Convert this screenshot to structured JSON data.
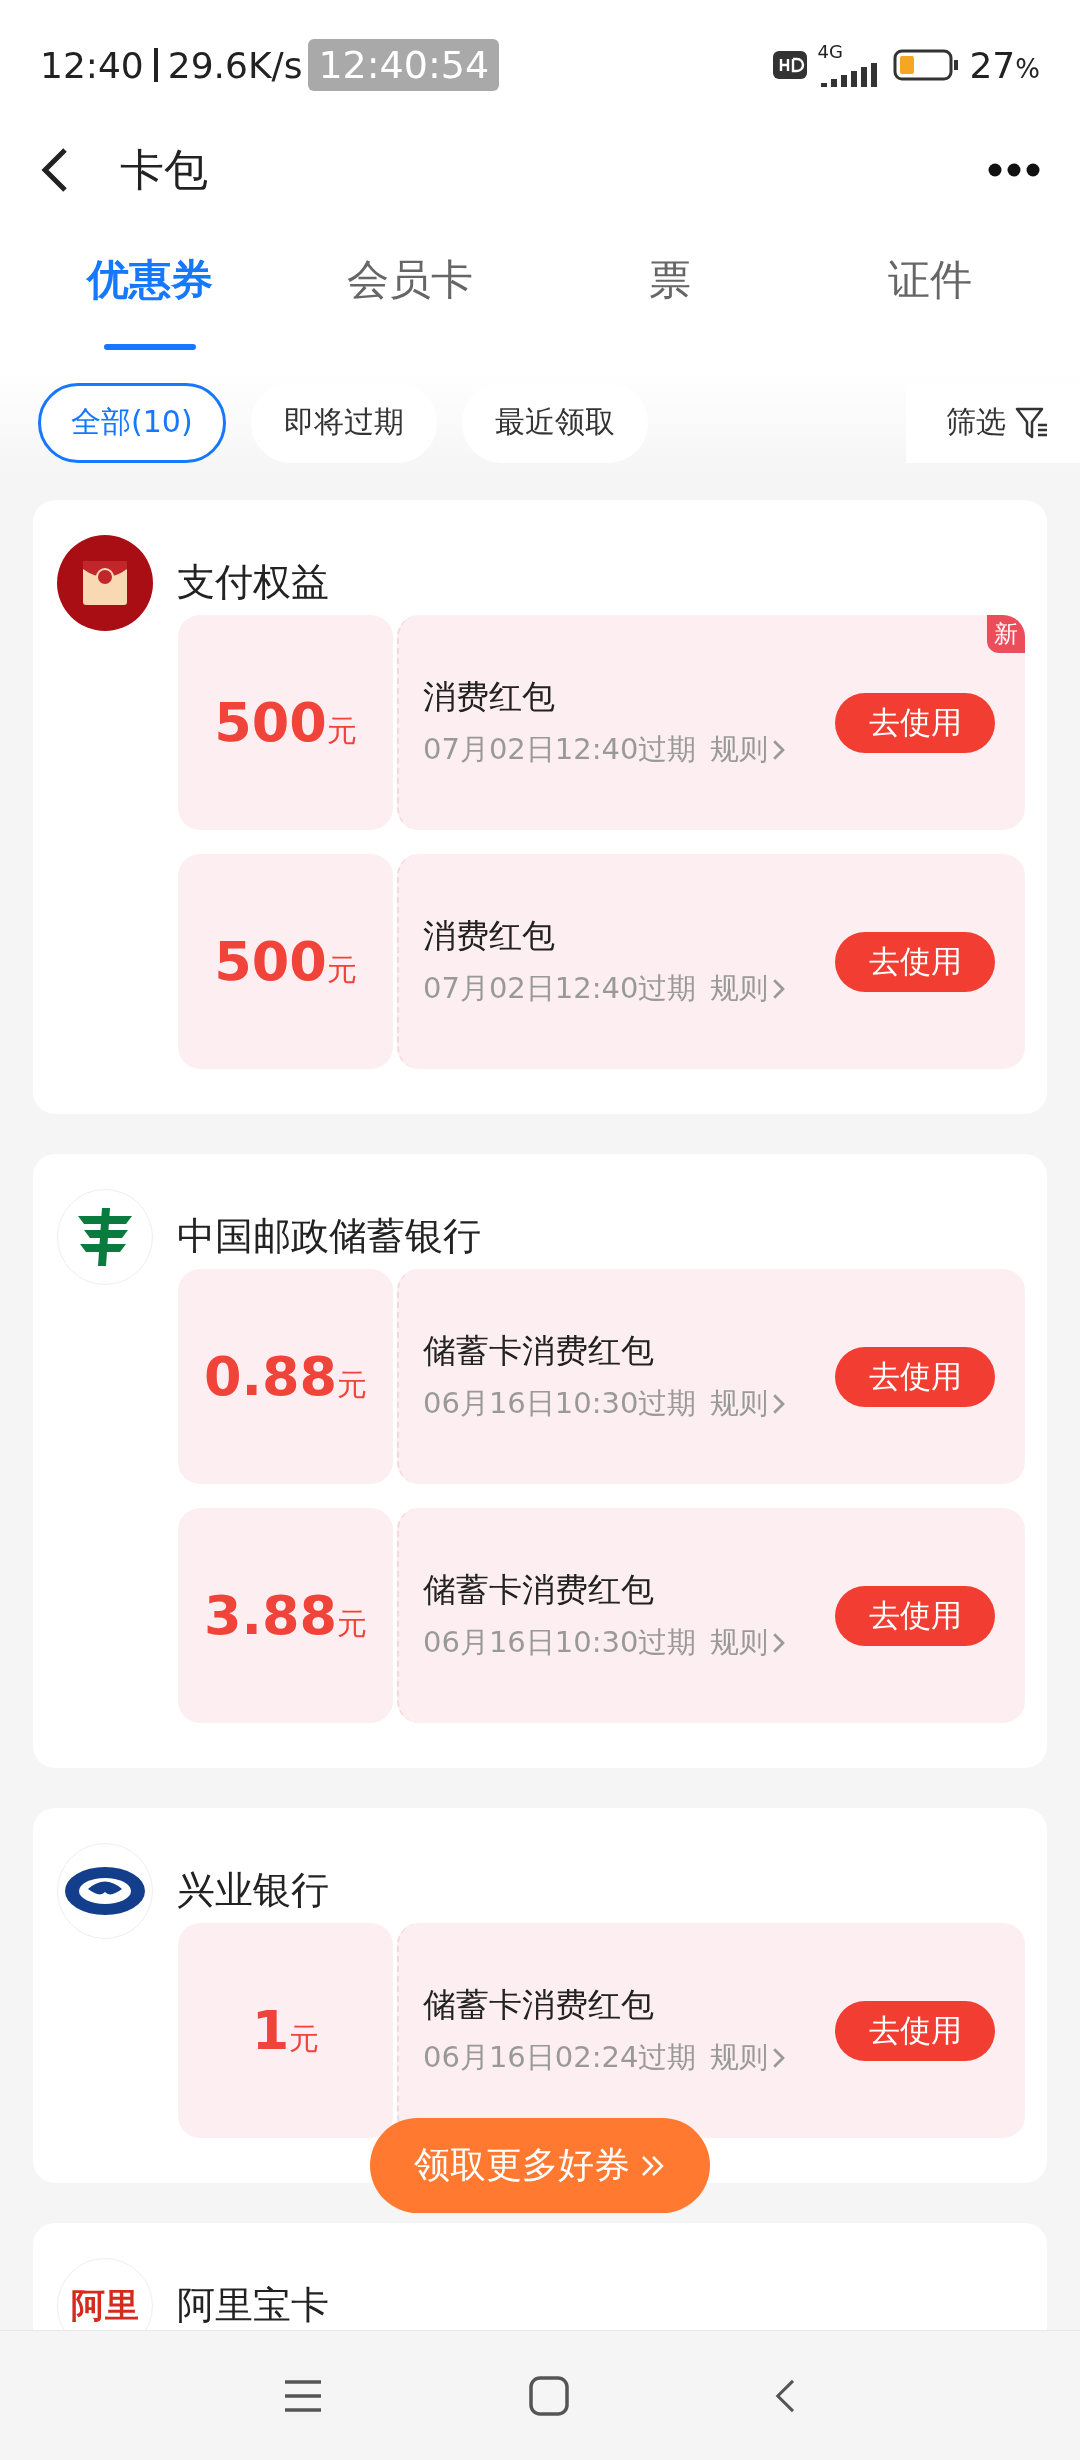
{
  "status_bar": {
    "time": "12:40",
    "speed": "29.6K/s",
    "overlay_time": "12:40:54",
    "network": "4G",
    "battery": "27",
    "battery_unit": "%"
  },
  "header": {
    "title": "卡包"
  },
  "tabs": [
    {
      "label": "优惠券",
      "selected": true
    },
    {
      "label": "会员卡",
      "selected": false
    },
    {
      "label": "票",
      "selected": false
    },
    {
      "label": "证件",
      "selected": false
    }
  ],
  "filters": [
    {
      "label": "全部(10)",
      "selected": true
    },
    {
      "label": "即将过期",
      "selected": false
    },
    {
      "label": "最近领取",
      "selected": false
    }
  ],
  "filter_button": {
    "label": "筛选"
  },
  "groups": [
    {
      "name": "支付权益",
      "coupons": [
        {
          "amount": "500",
          "unit": "元",
          "title": "消费红包",
          "expiry": "07月02日12:40过期",
          "rules": "规则",
          "action": "去使用",
          "badge": "新"
        },
        {
          "amount": "500",
          "unit": "元",
          "title": "消费红包",
          "expiry": "07月02日12:40过期",
          "rules": "规则",
          "action": "去使用"
        }
      ]
    },
    {
      "name": "中国邮政储蓄银行",
      "coupons": [
        {
          "amount": "0.88",
          "unit": "元",
          "title": "储蓄卡消费红包",
          "expiry": "06月16日10:30过期",
          "rules": "规则",
          "action": "去使用"
        },
        {
          "amount": "3.88",
          "unit": "元",
          "title": "储蓄卡消费红包",
          "expiry": "06月16日10:30过期",
          "rules": "规则",
          "action": "去使用"
        }
      ]
    },
    {
      "name": "兴业银行",
      "coupons": [
        {
          "amount": "1",
          "unit": "元",
          "title": "储蓄卡消费红包",
          "expiry": "06月16日02:24过期",
          "rules": "规则",
          "action": "去使用"
        }
      ]
    },
    {
      "name": "阿里宝卡",
      "logo_text": "阿里"
    }
  ],
  "floating_button": {
    "label": "领取更多好券"
  }
}
